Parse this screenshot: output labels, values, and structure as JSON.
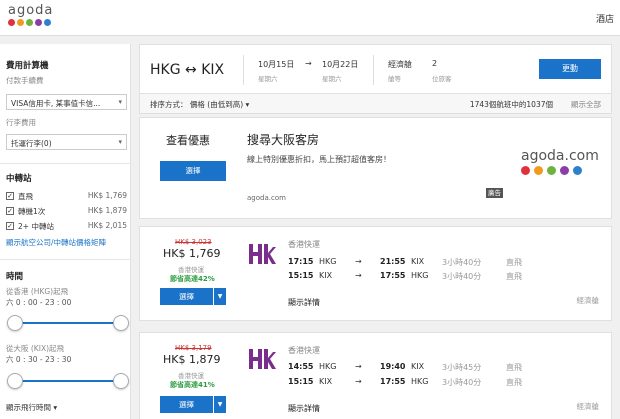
{
  "header": {
    "logo_text": "agoda",
    "logo_colors": [
      "#e0323c",
      "#f29a1f",
      "#6fb33f",
      "#8a3ea8",
      "#2f7fd0"
    ],
    "hotel_link": "酒店"
  },
  "sidebar": {
    "fee_title": "費用計算機",
    "payment_label": "付款手續費",
    "payment_value": "VISA信用卡, 某事值卡信...",
    "baggage_label": "行李費用",
    "baggage_value": "托運行李(0)",
    "stops_title": "中轉站",
    "stops": [
      {
        "label": "直飛",
        "price": "HK$ 1,769",
        "checked": "✓"
      },
      {
        "label": "轉機1次",
        "price": "HK$ 1,879",
        "checked": "✓"
      },
      {
        "label": "2+ 中轉站",
        "price": "HK$ 2,015",
        "checked": "✓"
      }
    ],
    "airline_link": "顯示航空公司/中轉站價格矩陣",
    "time_title": "時間",
    "depart_label": "從香港 (HKG)起飛",
    "depart_range": "六 0 : 00 - 23 : 00",
    "return_label": "從大阪 (KIX)起飛",
    "return_range": "六 0 : 30 - 23 : 30",
    "duration_label": "顯示飛行時間"
  },
  "search": {
    "route": "HKG ↔ KIX",
    "depart_date": "10月15日",
    "depart_day": "星期六",
    "arrow": "→",
    "return_date": "10月22日",
    "return_day": "星期六",
    "cabin": "經濟艙",
    "cabin_sub": "艙等",
    "passengers": "2",
    "passengers_sub": "位旅客",
    "update_label": "更動"
  },
  "sortbar": {
    "sort_label": "排序方式： 價格 (由低到高) ▾",
    "count": "1743個航班中的1037個",
    "show_all": "顯示全部"
  },
  "ad": {
    "left_title": "查看優惠",
    "button": "選擇",
    "title": "搜尋大阪客房",
    "desc": "線上特別優惠折扣，馬上預訂超值客房！",
    "url": "agoda.com",
    "logo_text": "agoda.com",
    "badge": "廣告"
  },
  "flights": [
    {
      "old_price": "HK$ 3,023",
      "price": "HK$ 1,769",
      "price_note": "香港快運",
      "save": "節省高達42%",
      "select": "選擇",
      "airline": "香港快運",
      "legs": [
        {
          "dep_time": "17:15",
          "dep": "HKG",
          "arr_time": "21:55",
          "arr": "KIX",
          "duration": "3小時40分",
          "stops": "直飛"
        },
        {
          "dep_time": "15:15",
          "dep": "KIX",
          "arr_time": "17:55",
          "arr": "HKG",
          "duration": "3小時40分",
          "stops": "直飛"
        }
      ],
      "details": "顯示詳情",
      "cabin": "經濟艙"
    },
    {
      "old_price": "HK$ 3,179",
      "price": "HK$ 1,879",
      "price_note": "香港快運",
      "save": "節省高達41%",
      "select": "選擇",
      "airline": "香港快運",
      "legs": [
        {
          "dep_time": "14:55",
          "dep": "HKG",
          "arr_time": "19:40",
          "arr": "KIX",
          "duration": "3小時45分",
          "stops": "直飛"
        },
        {
          "dep_time": "15:15",
          "dep": "KIX",
          "arr_time": "17:55",
          "arr": "HKG",
          "duration": "3小時40分",
          "stops": "直飛"
        }
      ],
      "details": "顯示詳情",
      "cabin": "經濟艙"
    }
  ],
  "colors": {
    "accent": "#1a73c8",
    "save_green": "#2a9d3e",
    "strike_red": "#cc3333",
    "airline_purple": "#7a2d8c"
  }
}
